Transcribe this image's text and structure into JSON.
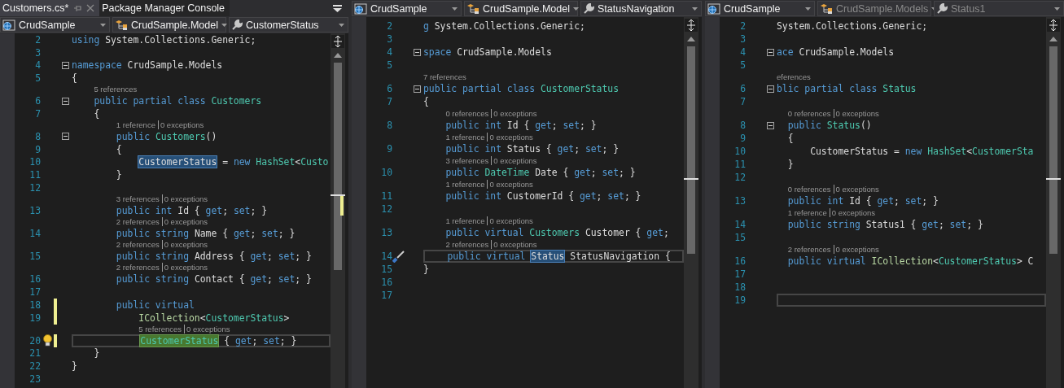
{
  "panes": [
    {
      "tabs": [
        {
          "label": "Customers.cs*",
          "selected": true
        },
        {
          "label": "Package Manager Console",
          "selected": false
        }
      ],
      "nav": [
        {
          "text": "CrudSample",
          "dimmed": false
        },
        {
          "text": "CrudSample.Model",
          "dimmed": false
        },
        {
          "text": "CustomerStatus",
          "dimmed": false
        }
      ],
      "lines": [
        {
          "num": "2",
          "changed": false,
          "current": false,
          "collapsible": false,
          "tokens": [
            {
              "text": "using",
              "kind": "kw"
            },
            {
              "text": " System.Collections.Generic;",
              "kind": "plain"
            }
          ]
        },
        {
          "num": "3",
          "changed": false,
          "current": false,
          "collapsible": false
        },
        {
          "num": "4",
          "changed": false,
          "current": false,
          "collapsible": true,
          "tokens": [
            {
              "text": "namespace",
              "kind": "kw"
            },
            {
              "text": " CrudSample.Models",
              "kind": "plain"
            }
          ]
        },
        {
          "num": "5",
          "changed": false,
          "current": false,
          "collapsible": false,
          "tokens": [
            {
              "text": "{",
              "kind": "plain"
            }
          ]
        },
        {
          "num": "6",
          "changed": false,
          "current": false,
          "collapsible": true,
          "lens": [
            "5 references"
          ],
          "tokens": [
            {
              "text": "    public partial class ",
              "kind": "kw"
            },
            {
              "text": "Customers",
              "kind": "type"
            }
          ]
        },
        {
          "num": "7",
          "changed": false,
          "current": false,
          "collapsible": false,
          "tokens": [
            {
              "text": "    {",
              "kind": "plain"
            }
          ]
        },
        {
          "num": "8",
          "changed": false,
          "current": false,
          "collapsible": true,
          "lens": [
            "1 reference",
            "0 exceptions"
          ],
          "tokens": [
            {
              "text": "        public ",
              "kind": "kw"
            },
            {
              "text": "Customers",
              "kind": "type"
            },
            {
              "text": "()",
              "kind": "plain"
            }
          ]
        },
        {
          "num": "9",
          "changed": false,
          "current": false,
          "collapsible": false,
          "tokens": [
            {
              "text": "        {",
              "kind": "plain"
            }
          ]
        },
        {
          "num": "10",
          "changed": false,
          "current": false,
          "collapsible": false,
          "tokens": [
            {
              "text": "            CustomerStatus",
              "kind": "ref"
            },
            {
              "text": " = ",
              "kind": "plain"
            },
            {
              "text": "new ",
              "kind": "kw"
            },
            {
              "text": "HashSet",
              "kind": "type"
            },
            {
              "text": "<",
              "kind": "plain"
            },
            {
              "text": "Custo",
              "kind": "type"
            }
          ]
        },
        {
          "num": "11",
          "changed": false,
          "current": false,
          "collapsible": false,
          "tokens": [
            {
              "text": "        }",
              "kind": "plain"
            }
          ]
        },
        {
          "num": "12",
          "changed": false,
          "current": false,
          "collapsible": false
        },
        {
          "num": "13",
          "changed": false,
          "current": false,
          "collapsible": false,
          "lens": [
            "3 references",
            "0 exceptions"
          ],
          "tokens": [
            {
              "text": "        public int ",
              "kind": "kw"
            },
            {
              "text": "Id { ",
              "kind": "plain"
            },
            {
              "text": "get",
              "kind": "kw"
            },
            {
              "text": "; ",
              "kind": "plain"
            },
            {
              "text": "set",
              "kind": "kw"
            },
            {
              "text": "; }",
              "kind": "plain"
            }
          ]
        },
        {
          "num": "14",
          "changed": false,
          "current": false,
          "collapsible": false,
          "lens": [
            "2 references",
            "0 exceptions"
          ],
          "tokens": [
            {
              "text": "        public string ",
              "kind": "kw"
            },
            {
              "text": "Name { ",
              "kind": "plain"
            },
            {
              "text": "get",
              "kind": "kw"
            },
            {
              "text": "; ",
              "kind": "plain"
            },
            {
              "text": "set",
              "kind": "kw"
            },
            {
              "text": "; }",
              "kind": "plain"
            }
          ]
        },
        {
          "num": "15",
          "changed": false,
          "current": false,
          "collapsible": false,
          "lens": [
            "2 references",
            "0 exceptions"
          ],
          "tokens": [
            {
              "text": "        public string ",
              "kind": "kw"
            },
            {
              "text": "Address { ",
              "kind": "plain"
            },
            {
              "text": "get",
              "kind": "kw"
            },
            {
              "text": "; ",
              "kind": "plain"
            },
            {
              "text": "set",
              "kind": "kw"
            },
            {
              "text": "; }",
              "kind": "plain"
            }
          ]
        },
        {
          "num": "16",
          "changed": false,
          "current": false,
          "collapsible": false,
          "lens": [
            "2 references",
            "0 exceptions"
          ],
          "tokens": [
            {
              "text": "        public string ",
              "kind": "kw"
            },
            {
              "text": "Contact { ",
              "kind": "plain"
            },
            {
              "text": "get",
              "kind": "kw"
            },
            {
              "text": "; ",
              "kind": "plain"
            },
            {
              "text": "set",
              "kind": "kw"
            },
            {
              "text": "; }",
              "kind": "plain"
            }
          ]
        },
        {
          "num": "17",
          "changed": false,
          "current": false,
          "collapsible": false
        },
        {
          "num": "18",
          "changed": true,
          "current": false,
          "collapsible": false,
          "tokens": [
            {
              "text": "        public virtual",
              "kind": "kw"
            }
          ]
        },
        {
          "num": "19",
          "changed": true,
          "current": false,
          "collapsible": false,
          "tokens": [
            {
              "text": "            ICollection",
              "kind": "iface"
            },
            {
              "text": "<",
              "kind": "plain"
            },
            {
              "text": "CustomerStatus",
              "kind": "type"
            },
            {
              "text": ">",
              "kind": "plain"
            }
          ]
        },
        {
          "num": "20",
          "changed": true,
          "current": true,
          "collapsible": false,
          "marker": {
            "kind": "lightbulb"
          },
          "lens": [
            "5 references",
            "0 exceptions"
          ],
          "tokens": [
            {
              "text": "            CustomerStatus",
              "kind": "def"
            },
            {
              "text": " { ",
              "kind": "plain"
            },
            {
              "text": "get",
              "kind": "kw"
            },
            {
              "text": "; ",
              "kind": "plain"
            },
            {
              "text": "set",
              "kind": "kw"
            },
            {
              "text": "; }",
              "kind": "plain"
            }
          ]
        },
        {
          "num": "21",
          "changed": false,
          "current": false,
          "collapsible": false,
          "tokens": [
            {
              "text": "    }",
              "kind": "plain"
            }
          ]
        },
        {
          "num": "22",
          "changed": false,
          "current": false,
          "collapsible": false,
          "tokens": [
            {
              "text": "}",
              "kind": "plain"
            }
          ]
        },
        {
          "num": "23",
          "changed": false,
          "current": false,
          "collapsible": false
        }
      ]
    },
    {
      "nav": [
        {
          "text": "CrudSample",
          "dimmed": false
        },
        {
          "text": "CrudSample.Model",
          "dimmed": false
        },
        {
          "text": "StatusNavigation",
          "dimmed": false
        }
      ],
      "lines": [
        {
          "num": "2",
          "changed": false,
          "current": false,
          "collapsible": false,
          "tokens": [
            {
              "text": "g",
              "kind": "kw"
            },
            {
              "text": " System.Collections.Generic;",
              "kind": "plain"
            }
          ]
        },
        {
          "num": "3",
          "changed": false,
          "current": false,
          "collapsible": false
        },
        {
          "num": "4",
          "changed": false,
          "current": false,
          "collapsible": true,
          "tokens": [
            {
              "text": "space",
              "kind": "kw"
            },
            {
              "text": " CrudSample.Models",
              "kind": "plain"
            }
          ]
        },
        {
          "num": "5",
          "changed": false,
          "current": false,
          "collapsible": false
        },
        {
          "num": "6",
          "changed": false,
          "current": false,
          "collapsible": true,
          "lens": [
            "7 references"
          ],
          "tokens": [
            {
              "text": "public partial class ",
              "kind": "kw"
            },
            {
              "text": "CustomerStatus",
              "kind": "type"
            }
          ]
        },
        {
          "num": "7",
          "changed": false,
          "current": false,
          "collapsible": false,
          "tokens": [
            {
              "text": "{",
              "kind": "plain"
            }
          ]
        },
        {
          "num": "8",
          "changed": false,
          "current": false,
          "collapsible": false,
          "lens": [
            "0 references",
            "0 exceptions"
          ],
          "tokens": [
            {
              "text": "    public int ",
              "kind": "kw"
            },
            {
              "text": "Id { ",
              "kind": "plain"
            },
            {
              "text": "get",
              "kind": "kw"
            },
            {
              "text": "; ",
              "kind": "plain"
            },
            {
              "text": "set",
              "kind": "kw"
            },
            {
              "text": "; }",
              "kind": "plain"
            }
          ]
        },
        {
          "num": "9",
          "changed": false,
          "current": false,
          "collapsible": false,
          "lens": [
            "1 reference",
            "0 exceptions"
          ],
          "tokens": [
            {
              "text": "    public int ",
              "kind": "kw"
            },
            {
              "text": "Status { ",
              "kind": "plain"
            },
            {
              "text": "get",
              "kind": "kw"
            },
            {
              "text": "; ",
              "kind": "plain"
            },
            {
              "text": "set",
              "kind": "kw"
            },
            {
              "text": "; }",
              "kind": "plain"
            }
          ]
        },
        {
          "num": "10",
          "changed": false,
          "current": false,
          "collapsible": false,
          "lens": [
            "3 references",
            "0 exceptions"
          ],
          "tokens": [
            {
              "text": "    public ",
              "kind": "kw"
            },
            {
              "text": "DateTime",
              "kind": "type"
            },
            {
              "text": " Date { ",
              "kind": "plain"
            },
            {
              "text": "get",
              "kind": "kw"
            },
            {
              "text": "; ",
              "kind": "plain"
            },
            {
              "text": "set",
              "kind": "kw"
            },
            {
              "text": "; }",
              "kind": "plain"
            }
          ]
        },
        {
          "num": "11",
          "changed": false,
          "current": false,
          "collapsible": false,
          "lens": [
            "1 reference",
            "0 exceptions"
          ],
          "tokens": [
            {
              "text": "    public int ",
              "kind": "kw"
            },
            {
              "text": "CustomerId { ",
              "kind": "plain"
            },
            {
              "text": "get",
              "kind": "kw"
            },
            {
              "text": "; ",
              "kind": "plain"
            },
            {
              "text": "set",
              "kind": "kw"
            },
            {
              "text": "; }",
              "kind": "plain"
            }
          ]
        },
        {
          "num": "12",
          "changed": false,
          "current": false,
          "collapsible": false
        },
        {
          "num": "13",
          "changed": false,
          "current": false,
          "collapsible": false,
          "lens": [
            "1 reference",
            "0 exceptions"
          ],
          "tokens": [
            {
              "text": "    public virtual ",
              "kind": "kw"
            },
            {
              "text": "Customers",
              "kind": "type"
            },
            {
              "text": " Customer { ",
              "kind": "plain"
            },
            {
              "text": "get",
              "kind": "kw"
            },
            {
              "text": ";",
              "kind": "plain"
            }
          ]
        },
        {
          "num": "14",
          "changed": false,
          "current": true,
          "collapsible": false,
          "marker": {
            "kind": "screwdriver"
          },
          "lens": [
            "2 references",
            "0 exceptions"
          ],
          "tokens": [
            {
              "text": "    public virtual ",
              "kind": "kw"
            },
            {
              "text": "Status",
              "kind": "ref"
            },
            {
              "text": " StatusNavigation {",
              "kind": "plain"
            }
          ]
        },
        {
          "num": "15",
          "changed": false,
          "current": false,
          "collapsible": false,
          "tokens": [
            {
              "text": "}",
              "kind": "plain"
            }
          ]
        },
        {
          "num": "16",
          "changed": false,
          "current": false,
          "collapsible": false
        },
        {
          "num": "17",
          "changed": false,
          "current": false,
          "collapsible": false
        }
      ]
    },
    {
      "nav": [
        {
          "text": "CrudSample",
          "dimmed": false
        },
        {
          "text": "CrudSample.Models",
          "dimmed": true
        },
        {
          "text": "Status1",
          "dimmed": true
        }
      ],
      "lines": [
        {
          "num": "2",
          "changed": false,
          "current": false,
          "collapsible": false,
          "tokens": [
            {
              "text": "System.Collections.Generic;",
              "kind": "plain"
            }
          ]
        },
        {
          "num": "3",
          "changed": false,
          "current": false,
          "collapsible": false
        },
        {
          "num": "4",
          "changed": false,
          "current": false,
          "collapsible": true,
          "tokens": [
            {
              "text": "ace",
              "kind": "kw"
            },
            {
              "text": " CrudSample.Models",
              "kind": "plain"
            }
          ]
        },
        {
          "num": "5",
          "changed": false,
          "current": false,
          "collapsible": false
        },
        {
          "num": "6",
          "changed": false,
          "current": false,
          "collapsible": true,
          "lens": [
            "eferences"
          ],
          "tokens": [
            {
              "text": "blic partial class ",
              "kind": "kw"
            },
            {
              "text": "Status",
              "kind": "type"
            }
          ]
        },
        {
          "num": "7",
          "changed": false,
          "current": false,
          "collapsible": false
        },
        {
          "num": "8",
          "changed": false,
          "current": false,
          "collapsible": true,
          "lens": [
            "0 references",
            "0 exceptions"
          ],
          "tokens": [
            {
              "text": "  public ",
              "kind": "kw"
            },
            {
              "text": "Status",
              "kind": "type"
            },
            {
              "text": "()",
              "kind": "plain"
            }
          ]
        },
        {
          "num": "9",
          "changed": false,
          "current": false,
          "collapsible": false,
          "tokens": [
            {
              "text": "  {",
              "kind": "plain"
            }
          ]
        },
        {
          "num": "10",
          "changed": false,
          "current": false,
          "collapsible": false,
          "tokens": [
            {
              "text": "      CustomerStatus = ",
              "kind": "plain"
            },
            {
              "text": "new ",
              "kind": "kw"
            },
            {
              "text": "HashSet",
              "kind": "type"
            },
            {
              "text": "<",
              "kind": "plain"
            },
            {
              "text": "CustomerSta",
              "kind": "type"
            }
          ]
        },
        {
          "num": "11",
          "changed": false,
          "current": false,
          "collapsible": false,
          "tokens": [
            {
              "text": "  }",
              "kind": "plain"
            }
          ]
        },
        {
          "num": "12",
          "changed": false,
          "current": false,
          "collapsible": false
        },
        {
          "num": "13",
          "changed": false,
          "current": false,
          "collapsible": false,
          "lens": [
            "0 references",
            "0 exceptions"
          ],
          "tokens": [
            {
              "text": "  public int ",
              "kind": "kw"
            },
            {
              "text": "Id { ",
              "kind": "plain"
            },
            {
              "text": "get",
              "kind": "kw"
            },
            {
              "text": "; ",
              "kind": "plain"
            },
            {
              "text": "set",
              "kind": "kw"
            },
            {
              "text": "; }",
              "kind": "plain"
            }
          ]
        },
        {
          "num": "14",
          "changed": false,
          "current": false,
          "collapsible": false,
          "lens": [
            "1 reference",
            "0 exceptions"
          ],
          "tokens": [
            {
              "text": "  public string ",
              "kind": "kw"
            },
            {
              "text": "Status1 { ",
              "kind": "plain"
            },
            {
              "text": "get",
              "kind": "kw"
            },
            {
              "text": "; ",
              "kind": "plain"
            },
            {
              "text": "set",
              "kind": "kw"
            },
            {
              "text": "; }",
              "kind": "plain"
            }
          ]
        },
        {
          "num": "15",
          "changed": false,
          "current": false,
          "collapsible": false
        },
        {
          "num": "16",
          "changed": false,
          "current": false,
          "collapsible": false,
          "lens": [
            "2 references",
            "0 exceptions"
          ],
          "tokens": [
            {
              "text": "  public virtual ",
              "kind": "kw"
            },
            {
              "text": "ICollection",
              "kind": "iface"
            },
            {
              "text": "<",
              "kind": "plain"
            },
            {
              "text": "CustomerStatus",
              "kind": "type"
            },
            {
              "text": "> C",
              "kind": "plain"
            }
          ]
        },
        {
          "num": "17",
          "changed": false,
          "current": false,
          "collapsible": false
        },
        {
          "num": "18",
          "changed": false,
          "current": false,
          "collapsible": false
        },
        {
          "num": "19",
          "changed": false,
          "current": true,
          "collapsible": false
        }
      ]
    }
  ]
}
